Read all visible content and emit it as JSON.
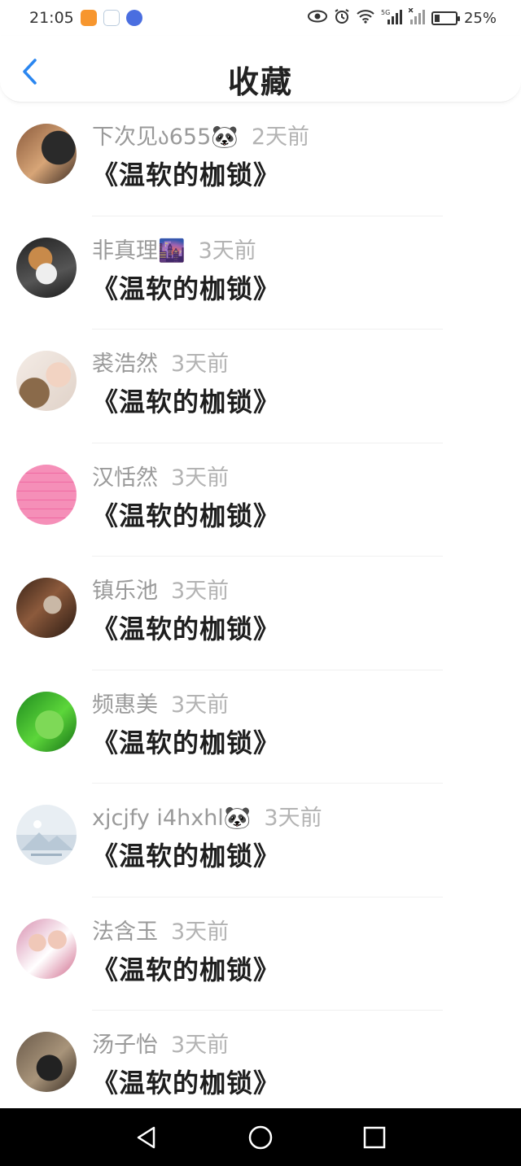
{
  "status": {
    "time": "21:05",
    "battery": "25%",
    "battery_level": 0.25,
    "network": "5G",
    "icons": [
      "eye-icon",
      "alarm-icon",
      "wifi-icon",
      "signal-icon",
      "signal-no-sim-icon",
      "battery-icon"
    ]
  },
  "header": {
    "title": "收藏",
    "back_icon": "chevron-left-icon"
  },
  "colors": {
    "accent": "#2a86f0",
    "title_text": "#222222",
    "meta_text": "#9a9a9a",
    "nav_bg": "#000000"
  },
  "items": [
    {
      "user": "下次见ა655🐼",
      "time": "2天前",
      "title": "《温软的枷锁》",
      "avatar": "girl-photo"
    },
    {
      "user": "非真理🌆",
      "time": "3天前",
      "title": "《温软的枷锁》",
      "avatar": "cat-photo"
    },
    {
      "user": "裘浩然",
      "time": "3天前",
      "title": "《温软的枷锁》",
      "avatar": "child-dog-photo"
    },
    {
      "user": "汉恬然",
      "time": "3天前",
      "title": "《温软的枷锁》",
      "avatar": "pink-text-image"
    },
    {
      "user": "镇乐池",
      "time": "3天前",
      "title": "《温软的枷锁》",
      "avatar": "artwork"
    },
    {
      "user": "频惠美",
      "time": "3天前",
      "title": "《温软的枷锁》",
      "avatar": "green-leaves"
    },
    {
      "user": "xjcjfy i4hxhl🐼",
      "time": "3天前",
      "title": "《温软的枷锁》",
      "avatar": "default-placeholder"
    },
    {
      "user": "法含玉",
      "time": "3天前",
      "title": "《温软的枷锁》",
      "avatar": "couple-photo"
    },
    {
      "user": "汤子怡",
      "time": "3天前",
      "title": "《温软的枷锁》",
      "avatar": "dark-portrait"
    }
  ],
  "nav": [
    "back-triangle-icon",
    "home-circle-icon",
    "recents-square-icon"
  ]
}
